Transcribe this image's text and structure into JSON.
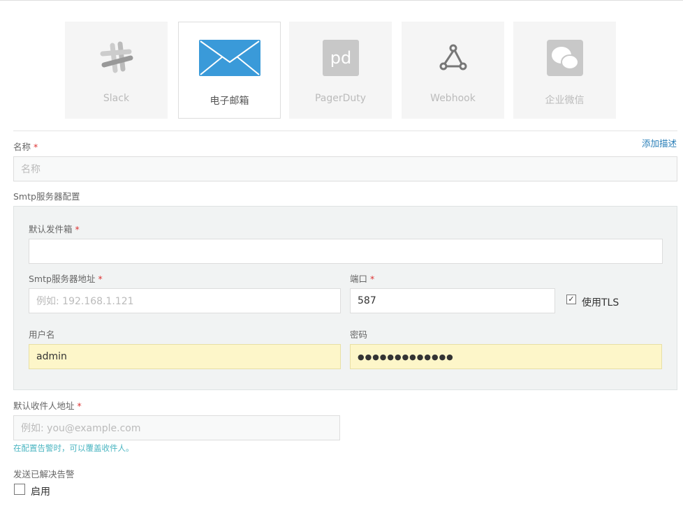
{
  "channels": [
    {
      "label": "Slack",
      "icon": "slack-icon"
    },
    {
      "label": "电子邮箱",
      "icon": "email-icon",
      "selected": true
    },
    {
      "label": "PagerDuty",
      "icon": "pagerduty-icon"
    },
    {
      "label": "Webhook",
      "icon": "webhook-icon"
    },
    {
      "label": "企业微信",
      "icon": "wechat-icon"
    }
  ],
  "form": {
    "name_label": "名称",
    "required_mark": "*",
    "add_description": "添加描述",
    "name_placeholder": "名称",
    "smtp_section": "Smtp服务器配置",
    "from_label": "默认发件箱",
    "from_value": "",
    "host_label": "Smtp服务器地址",
    "host_placeholder": "例如: 192.168.1.121",
    "port_label": "端口",
    "port_value": "587",
    "tls_label": "使用TLS",
    "tls_checked": true,
    "username_label": "用户名",
    "username_value": "admin",
    "password_label": "密码",
    "password_value": "●●●●●●●●●●●●●",
    "to_label": "默认收件人地址",
    "to_placeholder": "例如: you@example.com",
    "to_hint": "在配置告警时，可以覆盖收件人。",
    "resolved_label": "发送已解决告警",
    "enable_label": "启用",
    "enable_checked": false
  },
  "colors": {
    "accent": "#3a9ad9",
    "hint": "#4cb6c2",
    "link": "#2a7fb8"
  }
}
